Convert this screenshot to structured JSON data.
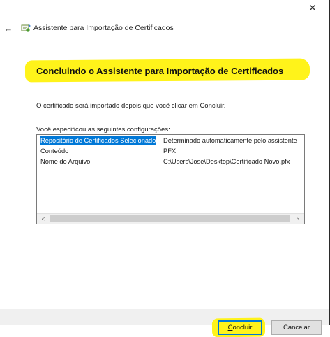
{
  "window": {
    "title": "Assistente para Importação de Certificados",
    "close_glyph": "✕",
    "back_glyph": "←"
  },
  "heading": "Concluindo o Assistente para Importação de Certificados",
  "info_text": "O certificado será importado depois que você clicar em Concluir.",
  "settings_label": "Você especificou as seguintes configurações:",
  "settings": [
    {
      "key": "Repositório de Certificados Selecionado",
      "value": "Determinado automaticamente pelo assistente",
      "selected": true
    },
    {
      "key": "Conteúdo",
      "value": "PFX",
      "selected": false
    },
    {
      "key": "Nome do Arquivo",
      "value": "C:\\Users\\Jose\\Desktop\\Certificado Novo.pfx",
      "selected": false
    }
  ],
  "scroll": {
    "left_glyph": "<",
    "right_glyph": ">"
  },
  "buttons": {
    "concluir_first": "C",
    "concluir_rest": "oncluir",
    "cancelar": "Cancelar"
  },
  "colors": {
    "highlight": "#fff31a",
    "selection": "#0078d7",
    "focus_border": "#0078d7"
  },
  "icons": {
    "close": "close-icon",
    "back": "back-arrow-icon",
    "wizard": "certificate-wizard-icon"
  }
}
